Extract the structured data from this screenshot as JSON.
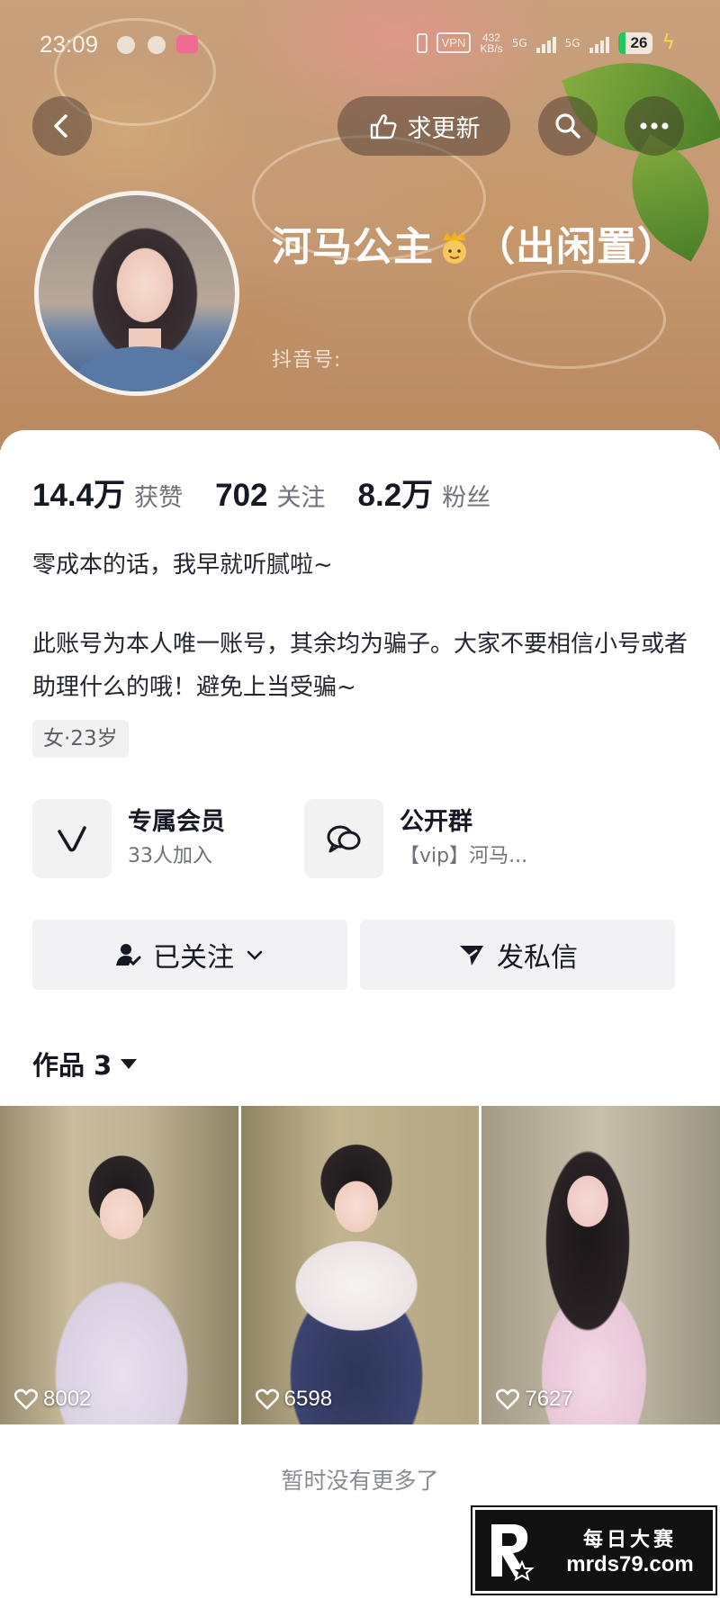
{
  "status_bar": {
    "time": "23:09",
    "vpn": "VPN",
    "net_speed": "432",
    "net_unit": "KB/s",
    "signal_1": "5G",
    "signal_2": "5G",
    "battery": "26"
  },
  "nav": {
    "update_label": "求更新"
  },
  "profile": {
    "name_part1": "河马公主",
    "name_part2": "（出闲置）",
    "douyin_id_label": "抖音号:",
    "stats": [
      {
        "value": "14.4万",
        "label": "获赞"
      },
      {
        "value": "702",
        "label": "关注"
      },
      {
        "value": "8.2万",
        "label": "粉丝"
      }
    ],
    "bio_line1": "零成本的话，我早就听腻啦~",
    "bio_line2": "此账号为本人唯一账号，其余均为骗子。大家不要相信小号或者助理什么的哦！避免上当受骗~",
    "tag": "女·23岁"
  },
  "entries": {
    "member": {
      "title": "专属会员",
      "sub": "33人加入"
    },
    "group": {
      "title": "公开群",
      "sub": "【vip】河马..."
    }
  },
  "actions": {
    "follow_label": "已关注",
    "message_label": "发私信"
  },
  "works": {
    "tab_label": "作品 3",
    "items": [
      {
        "likes": "8002"
      },
      {
        "likes": "6598"
      },
      {
        "likes": "7627"
      }
    ],
    "no_more": "暂时没有更多了"
  },
  "watermark": {
    "line1": "每日大赛",
    "line2": "mrds79.com"
  },
  "colors": {
    "accent_text": "#161823",
    "secondary_text": "#70727a",
    "button_bg": "#f2f2f4",
    "battery_green": "#22c55e"
  }
}
